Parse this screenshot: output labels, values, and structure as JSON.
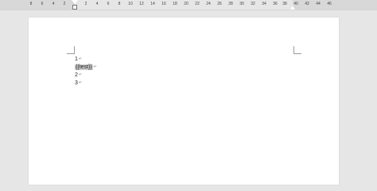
{
  "ruler": {
    "ticks": [
      "8",
      "6",
      "4",
      "2",
      "",
      "2",
      "4",
      "6",
      "8",
      "10",
      "12",
      "14",
      "16",
      "18",
      "20",
      "22",
      "24",
      "26",
      "28",
      "30",
      "32",
      "34",
      "36",
      "38",
      "40",
      "42",
      "44",
      "46"
    ]
  },
  "document": {
    "lines": [
      {
        "text": "1",
        "mark": "↵"
      },
      {
        "text": "{{test}}",
        "mark": "↵"
      },
      {
        "text": "2",
        "mark": "↵"
      },
      {
        "text": "3",
        "mark": "↵"
      }
    ]
  }
}
